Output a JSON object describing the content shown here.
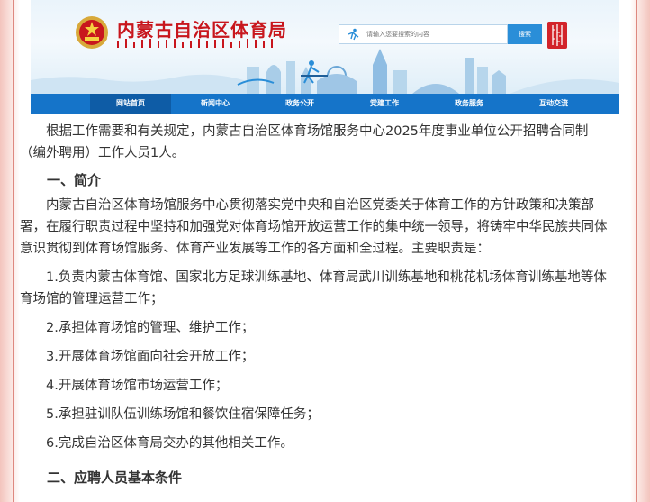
{
  "header": {
    "site_title": "内蒙古自治区体育局",
    "search_placeholder": "请输入您要搜索的内容",
    "search_button": "搜索"
  },
  "nav": {
    "items": [
      {
        "label": "网站首页",
        "active": true
      },
      {
        "label": "新闻中心"
      },
      {
        "label": "政务公开"
      },
      {
        "label": "党建工作"
      },
      {
        "label": "政务服务"
      },
      {
        "label": "互动交流"
      }
    ]
  },
  "article": {
    "intro": "根据工作需要和有关规定，内蒙古自治区体育场馆服务中心2025年度事业单位公开招聘合同制（编外聘用）工作人员1人。",
    "section1_heading": "一、简介",
    "section1_body": "内蒙古自治区体育场馆服务中心贯彻落实党中央和自治区党委关于体育工作的方针政策和决策部署，在履行职责过程中坚持和加强党对体育场馆开放运营工作的集中统一领导，将铸牢中华民族共同体意识贯彻到体育场馆服务、体育产业发展等工作的各方面和全过程。主要职责是：",
    "duties": [
      "1.负责内蒙古体育馆、国家北方足球训练基地、体育局武川训练基地和桃花机场体育训练基地等体育场馆的管理运营工作；",
      "2.承担体育场馆的管理、维护工作；",
      "3.开展体育场馆面向社会开放工作；",
      "4.开展体育场馆市场运营工作；",
      "5.承担驻训队伍训练场馆和餐饮住宿保障任务；",
      "6.完成自治区体育局交办的其他相关工作。"
    ],
    "section2_heading": "二、应聘人员基本条件"
  },
  "colors": {
    "brand_red": "#c8161d",
    "nav_blue": "#1574c9",
    "search_blue": "#2a8ed8",
    "text": "#333333"
  }
}
